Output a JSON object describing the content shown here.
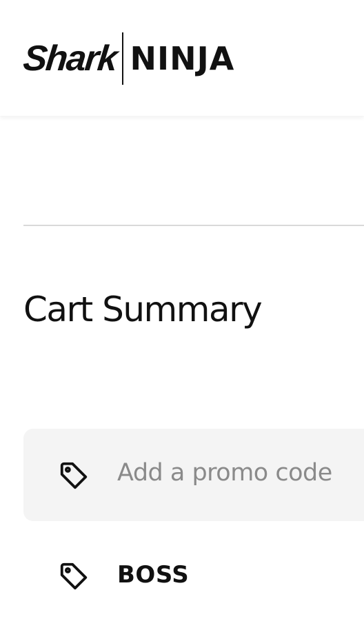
{
  "header": {
    "logo_shark": "Shark",
    "logo_ninja": "NINJA"
  },
  "cart": {
    "title": "Cart Summary"
  },
  "promo": {
    "placeholder": "Add a promo code",
    "icon": "tag-icon"
  },
  "applied_promo": {
    "code": "BOSS",
    "icon": "tag-icon"
  },
  "colors": {
    "text": "#111111",
    "placeholder": "#8a8a8a",
    "promo_background": "#f4f4f4",
    "divider": "#d9d9d9"
  }
}
